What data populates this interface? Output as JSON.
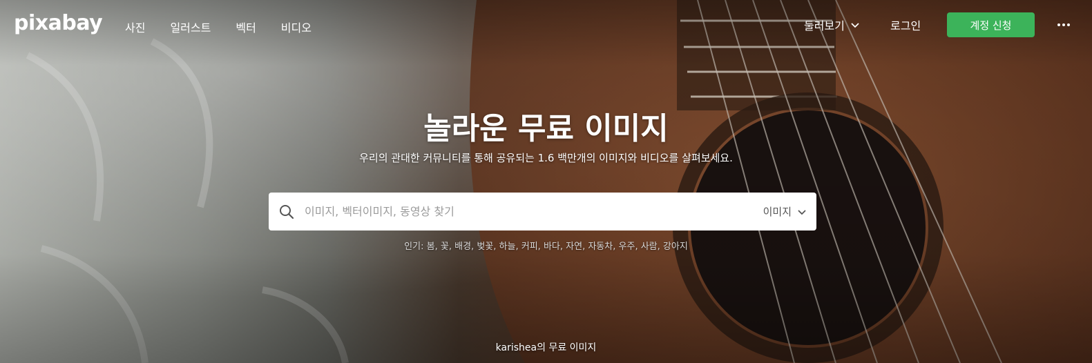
{
  "brand": {
    "logo_text": "pixabay"
  },
  "nav": {
    "links": [
      "사진",
      "일러스트",
      "벡터",
      "비디오"
    ],
    "explore_label": "둘러보기",
    "login_label": "로그인",
    "signup_label": "계정 신청"
  },
  "hero": {
    "title": "놀라운 무료 이미지",
    "subtitle": "우리의 관대한 커뮤니티를 통해 공유되는 1.6 백만개의 이미지와 비디오를 살펴보세요."
  },
  "search": {
    "placeholder": "이미지, 벡터이미지, 동영상 찾기",
    "value": "",
    "type_selected": "이미지"
  },
  "popular": {
    "label": "인기:",
    "tags": [
      "봄",
      "꽃",
      "배경",
      "벚꽃",
      "하늘",
      "커피",
      "바다",
      "자연",
      "자동차",
      "우주",
      "사람",
      "강아지"
    ]
  },
  "credit": {
    "author": "karishea",
    "text": "의 무료 이미지"
  },
  "colors": {
    "accent": "#3cb35a",
    "search_bg": "#ffffff",
    "text_light": "#ffffff"
  }
}
